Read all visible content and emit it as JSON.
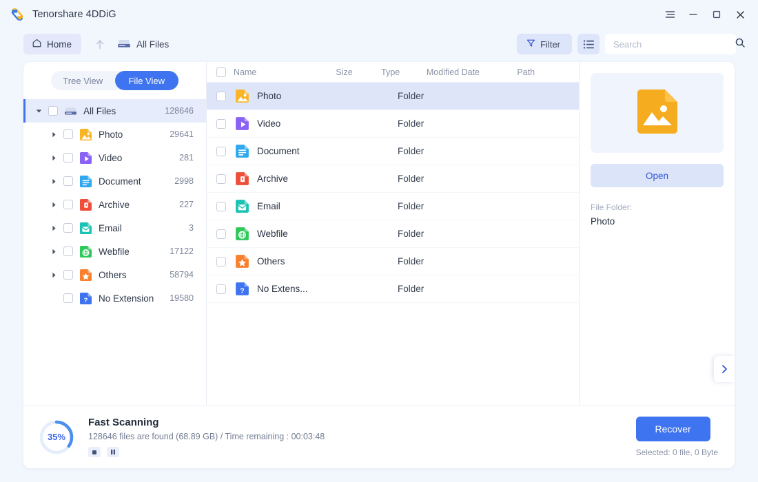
{
  "window": {
    "title": "Tenorshare 4DDiG",
    "controls": [
      {
        "name": "menu-icon",
        "label": "Menu"
      },
      {
        "name": "minimize-icon",
        "label": "Minimize"
      },
      {
        "name": "maximize-icon",
        "label": "Maximize"
      },
      {
        "name": "close-icon",
        "label": "Close"
      }
    ]
  },
  "toolbar": {
    "home_label": "Home",
    "home_icon": "home-icon",
    "up_icon": "arrow-up-icon",
    "breadcrumb_label": "All Files",
    "breadcrumb_icon": "drive-icon",
    "filter_label": "Filter",
    "filter_icon": "funnel-icon",
    "listview_icon": "list-view-icon",
    "search_placeholder": "Search",
    "search_value": "",
    "search_icon": "search-icon"
  },
  "sidebar": {
    "view_toggle": {
      "tree_label": "Tree View",
      "file_label": "File View",
      "active": "File View"
    },
    "nodes": [
      {
        "label": "All Files",
        "count": "128646",
        "level": "root",
        "icon": "drive-icon",
        "color": "#8a93c9",
        "expanded": true
      },
      {
        "label": "Photo",
        "count": "29641",
        "level": "child",
        "icon": "photo-icon",
        "color": "#fbb424"
      },
      {
        "label": "Video",
        "count": "281",
        "level": "child",
        "icon": "video-icon",
        "color": "#8a63f5"
      },
      {
        "label": "Document",
        "count": "2998",
        "level": "child",
        "icon": "document-icon",
        "color": "#2fa8ef"
      },
      {
        "label": "Archive",
        "count": "227",
        "level": "child",
        "icon": "archive-icon",
        "color": "#ef4f3a"
      },
      {
        "label": "Email",
        "count": "3",
        "level": "child",
        "icon": "email-icon",
        "color": "#17c3b2"
      },
      {
        "label": "Webfile",
        "count": "17122",
        "level": "child",
        "icon": "webfile-icon",
        "color": "#2fc85b"
      },
      {
        "label": "Others",
        "count": "58794",
        "level": "child",
        "icon": "others-icon",
        "color": "#f9802c"
      },
      {
        "label": "No Extension",
        "count": "19580",
        "level": "leaf",
        "icon": "no-extension-icon",
        "color": "#3f74f0"
      }
    ]
  },
  "filelist": {
    "columns": [
      "Name",
      "Size",
      "Type",
      "Modified Date",
      "Path"
    ],
    "rows": [
      {
        "name": "Photo",
        "size": "",
        "type": "Folder",
        "modified": "",
        "path": "",
        "icon": "photo-icon",
        "color": "#fbb424",
        "selected": true
      },
      {
        "name": "Video",
        "size": "",
        "type": "Folder",
        "modified": "",
        "path": "",
        "icon": "video-icon",
        "color": "#8a63f5",
        "selected": false
      },
      {
        "name": "Document",
        "size": "",
        "type": "Folder",
        "modified": "",
        "path": "",
        "icon": "document-icon",
        "color": "#2fa8ef",
        "selected": false
      },
      {
        "name": "Archive",
        "size": "",
        "type": "Folder",
        "modified": "",
        "path": "",
        "icon": "archive-icon",
        "color": "#ef4f3a",
        "selected": false
      },
      {
        "name": "Email",
        "size": "",
        "type": "Folder",
        "modified": "",
        "path": "",
        "icon": "email-icon",
        "color": "#17c3b2",
        "selected": false
      },
      {
        "name": "Webfile",
        "size": "",
        "type": "Folder",
        "modified": "",
        "path": "",
        "icon": "webfile-icon",
        "color": "#2fc85b",
        "selected": false
      },
      {
        "name": "Others",
        "size": "",
        "type": "Folder",
        "modified": "",
        "path": "",
        "icon": "others-icon",
        "color": "#f9802c",
        "selected": false
      },
      {
        "name": "No Extens...",
        "size": "",
        "type": "Folder",
        "modified": "",
        "path": "",
        "icon": "no-extension-icon",
        "color": "#3f74f0",
        "selected": false
      }
    ]
  },
  "preview": {
    "thumb_icon": "photo-icon",
    "thumb_color": "#f5ac1e",
    "open_label": "Open",
    "meta_label": "File Folder:",
    "meta_value": "Photo",
    "next_icon": "chevron-right-icon"
  },
  "status": {
    "progress_percent": "35%",
    "progress_value": 35,
    "title": "Fast Scanning",
    "subtitle": "128646 files are found (68.89 GB) /  Time remaining : 00:03:48",
    "stop_icon": "stop-icon",
    "pause_icon": "pause-icon",
    "recover_label": "Recover",
    "selected_text": "Selected: 0 file, 0 Byte"
  },
  "colors": {
    "accent": "#3f74f0",
    "accent_soft": "#dce4fa",
    "row_selected": "#dfe5f9",
    "app_bg": "#f2f6fd"
  }
}
